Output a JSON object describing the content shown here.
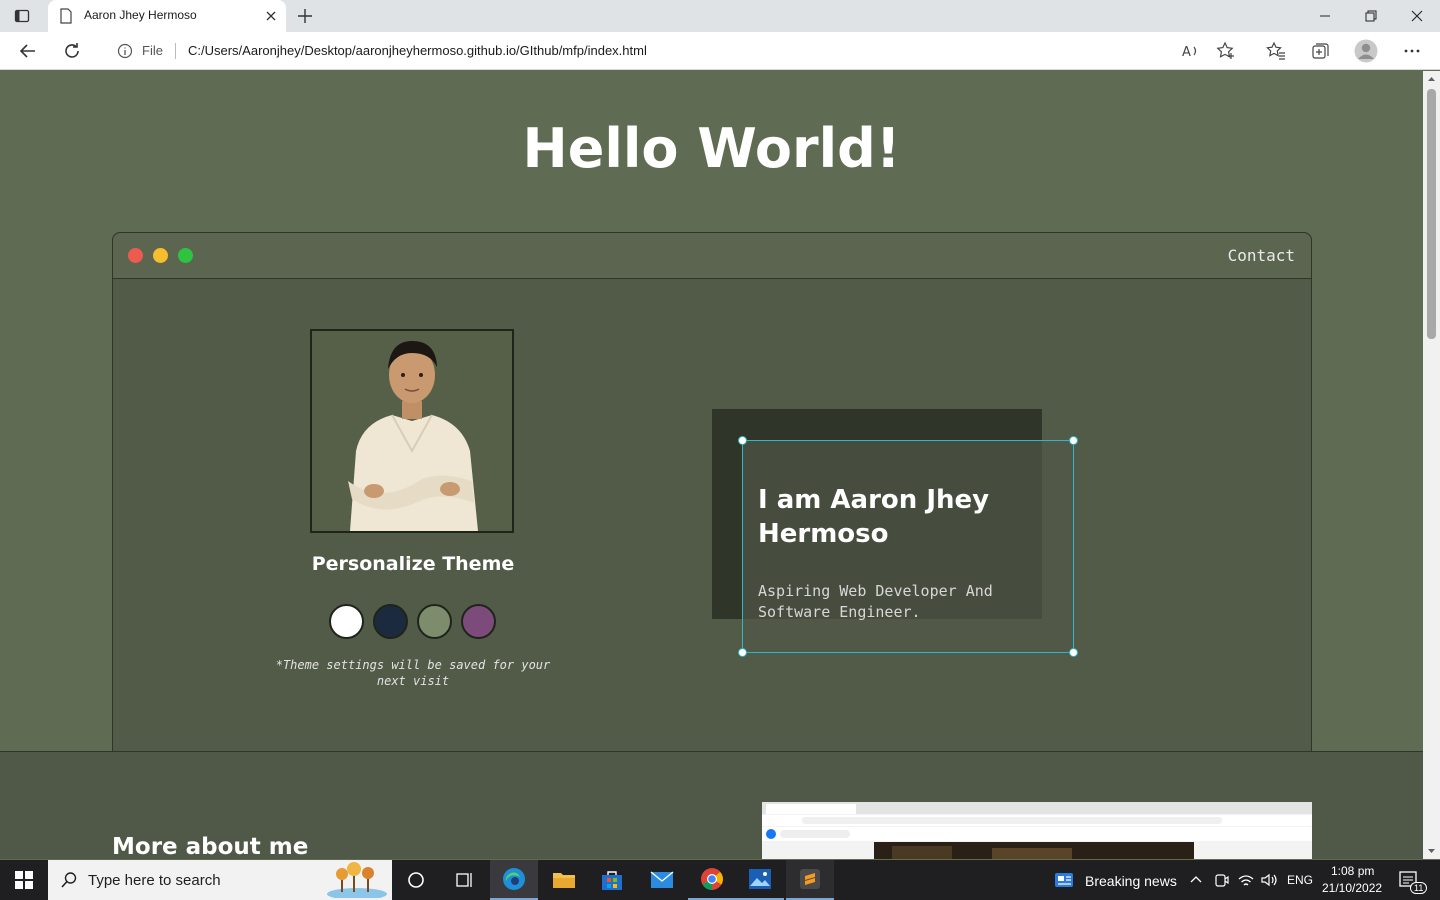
{
  "browser": {
    "tab_title": "Aaron Jhey Hermoso",
    "file_label": "File",
    "url": "C:/Users/Aaronjhey/Desktop/aaronjheyhermoso.github.io/GIthub/mfp/index.html"
  },
  "hero": {
    "title": "Hello World!"
  },
  "window": {
    "nav_contact": "Contact",
    "dot_colors": [
      "#ed5a50",
      "#f6bd2d",
      "#2fc440"
    ]
  },
  "theme": {
    "title": "Personalize Theme",
    "swatches": [
      "#ffffff",
      "#1c2a3f",
      "#7d8c6d",
      "#7c4b7c"
    ],
    "note": "*Theme settings will be saved for your next visit"
  },
  "intro": {
    "name": "I am Aaron Jhey Hermoso",
    "subtitle": "Aspiring Web Developer And Software Engineer."
  },
  "more": {
    "title": "More about me"
  },
  "taskbar": {
    "search_placeholder": "Type here to search",
    "news": "Breaking news",
    "lang": "ENG",
    "time": "1:08 pm",
    "date": "21/10/2022",
    "notification_count": "11"
  }
}
